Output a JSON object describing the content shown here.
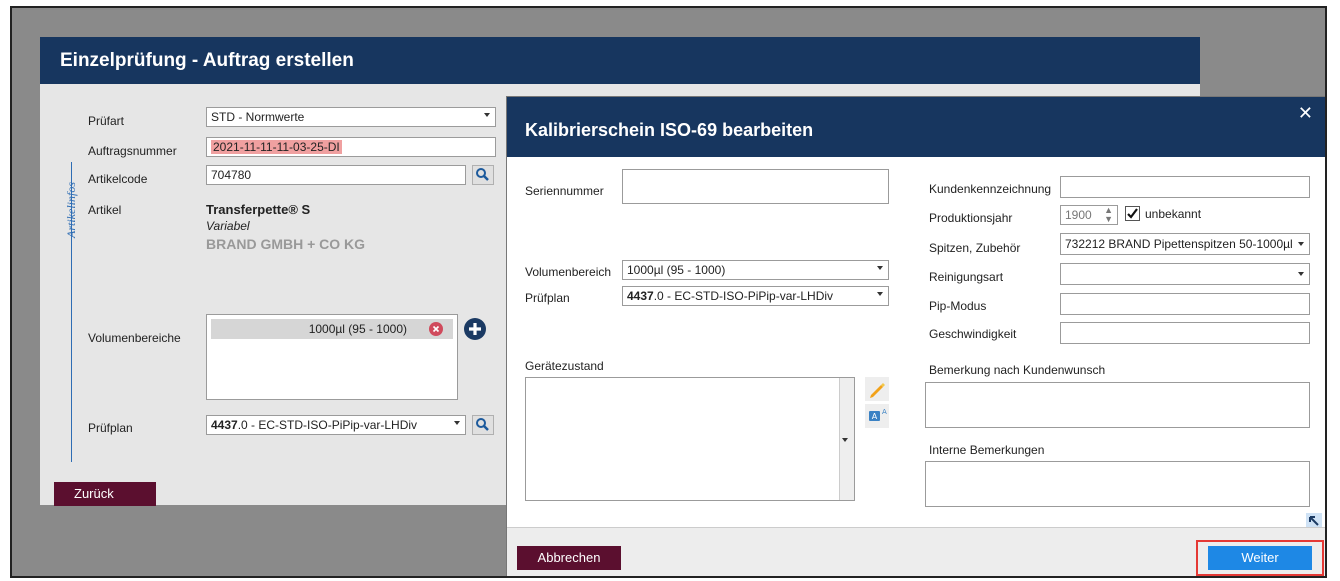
{
  "window": {
    "title": "Einzelprüfung - Auftrag erstellen"
  },
  "form": {
    "pruefart_label": "Prüfart",
    "pruefart_value": "STD - Normwerte",
    "auftragsnummer_label": "Auftragsnummer",
    "auftragsnummer_value": "2021-11-11-11-03-25-DI",
    "sidebar_label": "Artikelinfos",
    "artikelcode_label": "Artikelcode",
    "artikelcode_value": "704780",
    "artikel_label": "Artikel",
    "artikel_name": "Transferpette® S",
    "artikel_variant": "Variabel",
    "artikel_company": "BRAND GMBH + CO KG",
    "volumenbereiche_label": "Volumenbereiche",
    "volumen_chip": "1000µl (95 - 1000)",
    "pruefplan_label": "Prüfplan",
    "pruefplan_bold": "4437",
    "pruefplan_rest": ".0 - EC-STD-ISO-PiPip-var-LHDiv",
    "back_button": "Zurück"
  },
  "dialog": {
    "title": "Kalibrierschein ISO-69 bearbeiten",
    "close": "✕",
    "seriennummer_label": "Seriennummer",
    "seriennummer_value": "",
    "volumenbereich_label": "Volumenbereich",
    "volumenbereich_value": "1000µl (95 - 1000)",
    "pruefplan_label": "Prüfplan",
    "pruefplan_bold": "4437",
    "pruefplan_rest": ".0 - EC-STD-ISO-PiPip-var-LHDiv",
    "geraetezustand_label": "Gerätezustand",
    "kundenkennzeichnung_label": "Kundenkennzeichnung",
    "kundenkennzeichnung_value": "",
    "produktionsjahr_label": "Produktionsjahr",
    "produktionsjahr_value": "1900",
    "unbekannt_label": "unbekannt",
    "unbekannt_checked": true,
    "spitzen_label": "Spitzen, Zubehör",
    "spitzen_value": "732212 BRAND Pipettenspitzen 50-1000µl",
    "reinigungsart_label": "Reinigungsart",
    "reinigungsart_value": "",
    "pipmodus_label": "Pip-Modus",
    "pipmodus_value": "",
    "geschwindigkeit_label": "Geschwindigkeit",
    "geschwindigkeit_value": "",
    "bemerkung_kunde_label": "Bemerkung nach Kundenwunsch",
    "interne_bemerkungen_label": "Interne Bemerkungen",
    "cancel_button": "Abbrechen",
    "next_button": "Weiter"
  },
  "colors": {
    "header": "#17365f",
    "button_dark": "#5b0f2f",
    "button_primary": "#1e88e5",
    "highlight": "#e53935"
  }
}
